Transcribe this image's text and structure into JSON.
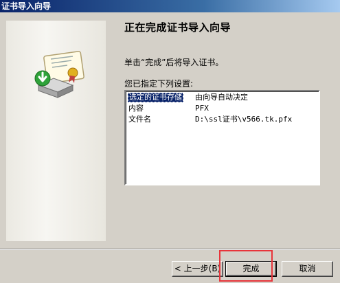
{
  "window": {
    "title": "证书导入向导"
  },
  "header": {
    "title": "正在完成证书导入向导"
  },
  "content": {
    "instruction": "单击“完成”后将导入证书。",
    "settings_label": "您已指定下列设置:",
    "settings": [
      {
        "key": "选定的证书存储",
        "value": "由向导自动决定"
      },
      {
        "key": "内容",
        "value": "PFX"
      },
      {
        "key": "文件名",
        "value": "D:\\ssl证书\\v566.tk.pfx"
      }
    ]
  },
  "buttons": {
    "back": "< 上一步(B)",
    "finish": "完成",
    "cancel": "取消"
  },
  "icons": {
    "wizard": "certificate-install-icon"
  },
  "colors": {
    "highlight": "#e8343a",
    "selection": "#0a246a",
    "titlebar": "#0a246a"
  }
}
